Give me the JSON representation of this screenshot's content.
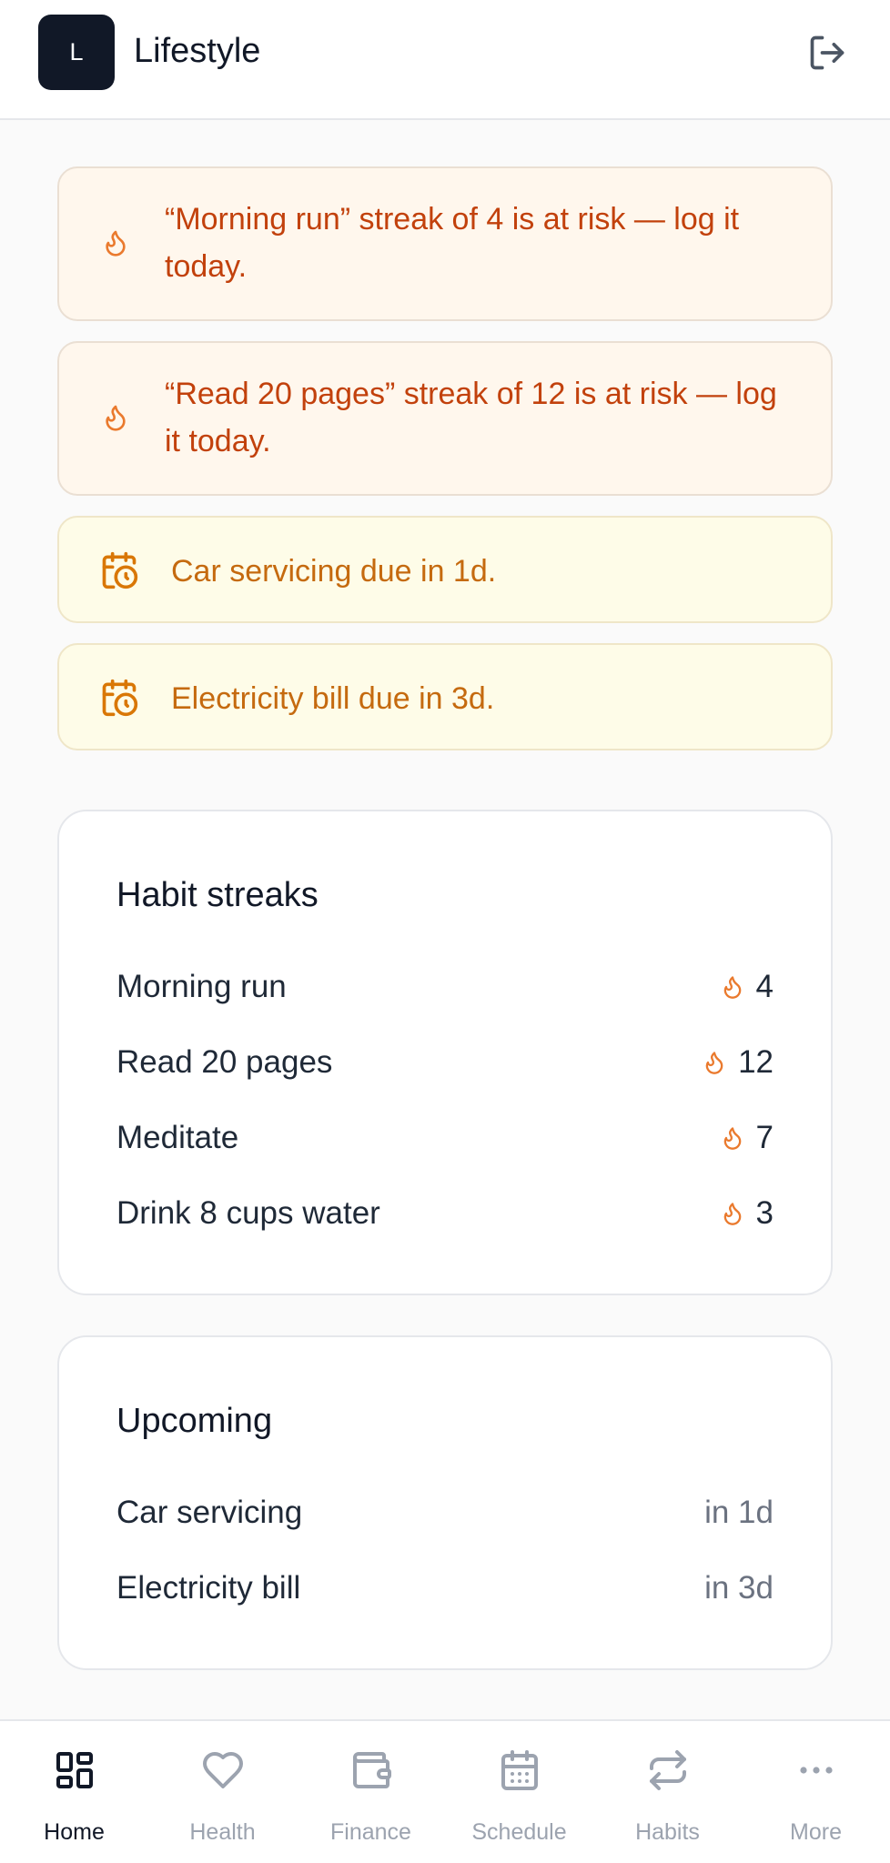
{
  "header": {
    "logo_letter": "L",
    "title": "Lifestyle",
    "logout_icon": "logout-icon"
  },
  "alerts": [
    {
      "type": "streak",
      "icon": "flame-icon",
      "text": "“Morning run” streak of 4 is at risk — log it today."
    },
    {
      "type": "streak",
      "icon": "flame-icon",
      "text": "“Read 20 pages” streak of 12 is at risk — log it today."
    },
    {
      "type": "due",
      "icon": "calendar-clock-icon",
      "text": "Car servicing due in 1d."
    },
    {
      "type": "due",
      "icon": "calendar-clock-icon",
      "text": "Electricity bill due in 3d."
    }
  ],
  "habit_streaks": {
    "title": "Habit streaks",
    "items": [
      {
        "label": "Morning run",
        "count": "4"
      },
      {
        "label": "Read 20 pages",
        "count": "12"
      },
      {
        "label": "Meditate",
        "count": "7"
      },
      {
        "label": "Drink 8 cups water",
        "count": "3"
      }
    ]
  },
  "upcoming": {
    "title": "Upcoming",
    "items": [
      {
        "label": "Car servicing",
        "due": "in 1d"
      },
      {
        "label": "Electricity bill",
        "due": "in 3d"
      }
    ]
  },
  "nav": {
    "items": [
      {
        "label": "Home",
        "icon": "grid-icon",
        "active": true
      },
      {
        "label": "Health",
        "icon": "heart-icon",
        "active": false
      },
      {
        "label": "Finance",
        "icon": "wallet-icon",
        "active": false
      },
      {
        "label": "Schedule",
        "icon": "calendar-icon",
        "active": false
      },
      {
        "label": "Habits",
        "icon": "repeat-icon",
        "active": false
      },
      {
        "label": "More",
        "icon": "more-icon",
        "active": false
      }
    ]
  },
  "colors": {
    "streak_text": "#c2410c",
    "streak_bg": "#fff7ed",
    "due_text": "#c56a0f",
    "due_bg": "#fefce8",
    "flame": "#ea7a2e",
    "logo_bg": "#111827"
  }
}
